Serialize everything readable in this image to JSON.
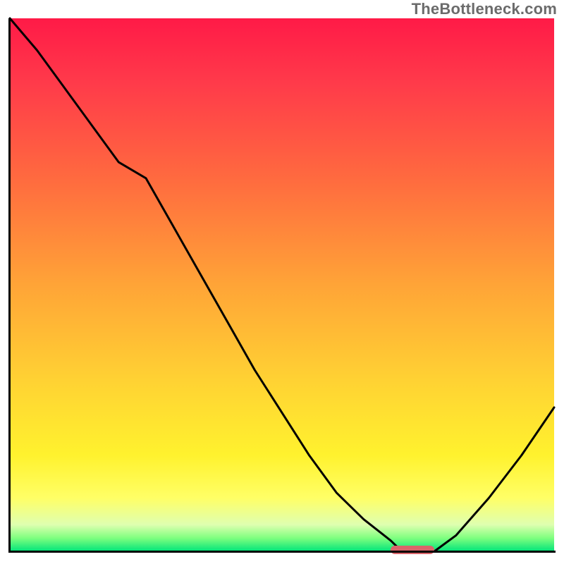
{
  "watermark": "TheBottleneck.com",
  "colors": {
    "gradient_top": "#ff1a47",
    "gradient_mid1": "#ff6a3f",
    "gradient_mid2": "#ffd233",
    "gradient_mid3": "#ffff66",
    "gradient_bottom": "#00e47a",
    "curve": "#000000",
    "marker": "#d9636a",
    "axis": "#000000"
  },
  "chart_data": {
    "type": "line",
    "title": "",
    "xlabel": "",
    "ylabel": "",
    "x": [
      0,
      5,
      10,
      15,
      20,
      25,
      30,
      35,
      40,
      45,
      50,
      55,
      60,
      65,
      70,
      72,
      75,
      78,
      82,
      88,
      94,
      100
    ],
    "values": [
      100,
      94,
      87,
      80,
      73,
      70,
      61,
      52,
      43,
      34,
      26,
      18,
      11,
      6,
      2,
      0,
      0,
      0,
      3,
      10,
      18,
      27
    ],
    "xlim": [
      0,
      100
    ],
    "ylim": [
      0,
      100
    ],
    "marker": {
      "x_start": 70,
      "x_end": 78,
      "y": 0
    },
    "note": "Values approximate the visible curve: steep fall from top-left, slight shoulder near x≈25, valley (floor) around x≈70–78, then partial rise toward the right edge."
  }
}
